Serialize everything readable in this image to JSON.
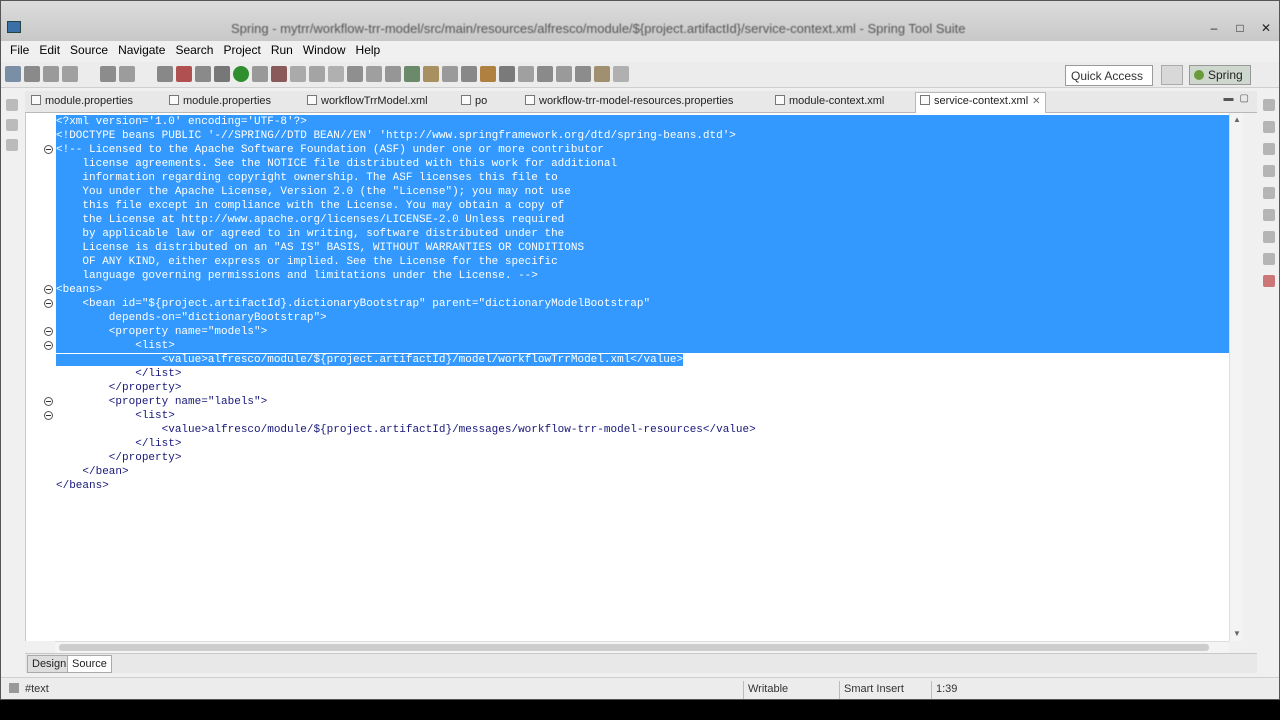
{
  "window": {
    "title": "Spring - mytrr/workflow-trr-model/src/main/resources/alfresco/module/${project.artifactId}/service-context.xml - Spring Tool Suite",
    "controls": [
      "–",
      "□",
      "✕"
    ]
  },
  "menu": [
    "File",
    "Edit",
    "Source",
    "Navigate",
    "Search",
    "Project",
    "Run",
    "Window",
    "Help"
  ],
  "toolbar": {
    "quick_access": "Quick Access",
    "perspective": "Spring"
  },
  "tabs": [
    {
      "label": "module.properties",
      "icon": "properties-file-icon",
      "active": false
    },
    {
      "label": "module.properties",
      "icon": "properties-file-icon",
      "active": false
    },
    {
      "label": "workflowTrrModel.xml",
      "icon": "xml-file-icon",
      "active": false
    },
    {
      "label": "po",
      "icon": "pom-file-icon",
      "active": false
    },
    {
      "label": "workflow-trr-model-resources.properties",
      "icon": "properties-file-icon",
      "active": false
    },
    {
      "label": "module-context.xml",
      "icon": "xml-file-icon",
      "active": false
    },
    {
      "label": "service-context.xml",
      "icon": "xml-file-icon",
      "active": true
    }
  ],
  "code_lines": [
    "<?xml version='1.0' encoding='UTF-8'?>",
    "<!DOCTYPE beans PUBLIC '-//SPRING//DTD BEAN//EN' 'http://www.springframework.org/dtd/spring-beans.dtd'>",
    "<!-- Licensed to the Apache Software Foundation (ASF) under one or more contributor",
    "    license agreements. See the NOTICE file distributed with this work for additional",
    "    information regarding copyright ownership. The ASF licenses this file to",
    "    You under the Apache License, Version 2.0 (the \"License\"); you may not use",
    "    this file except in compliance with the License. You may obtain a copy of",
    "    the License at http://www.apache.org/licenses/LICENSE-2.0 Unless required",
    "    by applicable law or agreed to in writing, software distributed under the",
    "    License is distributed on an \"AS IS\" BASIS, WITHOUT WARRANTIES OR CONDITIONS",
    "    OF ANY KIND, either express or implied. See the License for the specific",
    "    language governing permissions and limitations under the License. -->",
    "<beans>",
    "    <bean id=\"${project.artifactId}.dictionaryBootstrap\" parent=\"dictionaryModelBootstrap\"",
    "        depends-on=\"dictionaryBootstrap\">",
    "        <property name=\"models\">",
    "            <list>",
    "                <value>alfresco/module/${project.artifactId}/model/workflowTrrModel.xml</value>",
    "            </list>",
    "        </property>",
    "        <property name=\"labels\">",
    "            <list>",
    "                <value>alfresco/module/${project.artifactId}/messages/workflow-trr-model-resources</value>",
    "            </list>",
    "        </property>",
    "    </bean>",
    "</beans>"
  ],
  "modes": [
    {
      "label": "Design",
      "active": false
    },
    {
      "label": "Source",
      "active": true
    }
  ],
  "status": {
    "left": "#text",
    "writable": "Writable",
    "insert_mode": "Smart Insert",
    "position": "1:39"
  }
}
